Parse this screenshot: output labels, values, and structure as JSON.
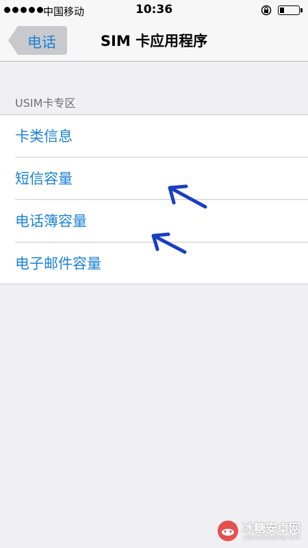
{
  "status_bar": {
    "carrier": "中国移动",
    "time": "10:36",
    "battery_level": 0.22
  },
  "nav": {
    "back_label": "电话",
    "title": "SIM 卡应用程序"
  },
  "section": {
    "header": "USIM卡专区",
    "items": [
      {
        "label": "卡类信息"
      },
      {
        "label": "短信容量"
      },
      {
        "label": "电话簿容量"
      },
      {
        "label": "电子邮件容量"
      }
    ]
  },
  "annotations": {
    "arrow_color": "#1a3ec4"
  },
  "watermark": {
    "title": "冰糖安卓网",
    "url": "www.btxtdmy.com"
  }
}
